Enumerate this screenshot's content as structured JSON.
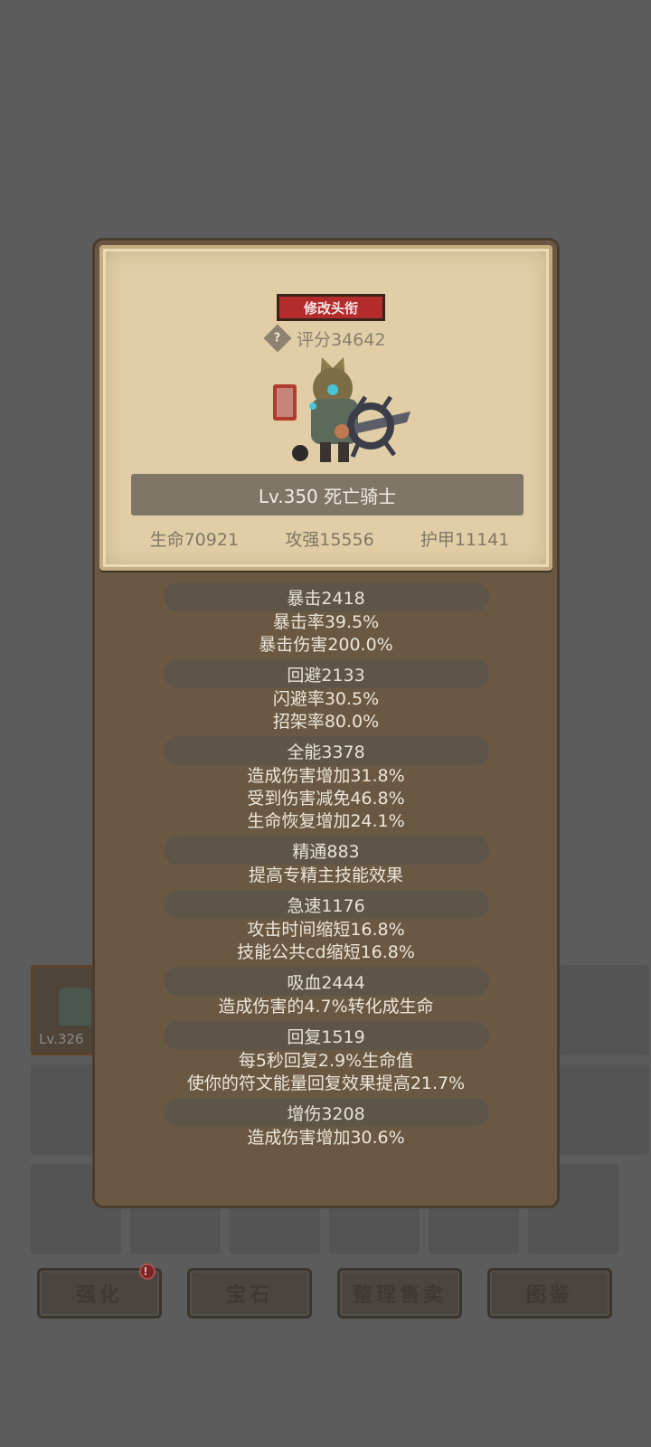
{
  "card": {
    "rename_label": "修改头衔",
    "help_glyph": "?",
    "score": "评分34642",
    "name": "Lv.350 死亡骑士",
    "hp": "生命70921",
    "attack": "攻强15556",
    "armor": "护甲11141"
  },
  "attributes": [
    {
      "title": "暴击2418",
      "lines": [
        "暴击率39.5%",
        "暴击伤害200.0%"
      ]
    },
    {
      "title": "回避2133",
      "lines": [
        "闪避率30.5%",
        "招架率80.0%"
      ]
    },
    {
      "title": "全能3378",
      "lines": [
        "造成伤害增加31.8%",
        "受到伤害减免46.8%",
        "生命恢复增加24.1%"
      ]
    },
    {
      "title": "精通883",
      "lines": [
        "提高专精主技能效果"
      ]
    },
    {
      "title": "急速1176",
      "lines": [
        "攻击时间缩短16.8%",
        "技能公共cd缩短16.8%"
      ]
    },
    {
      "title": "吸血2444",
      "lines": [
        "造成伤害的4.7%转化成生命"
      ]
    },
    {
      "title": "回复1519",
      "lines": [
        "每5秒回复2.9%生命值",
        "使你的符文能量回复效果提高21.7%"
      ]
    },
    {
      "title": "增伤3208",
      "lines": [
        "造成伤害增加30.6%"
      ]
    }
  ],
  "inventory": {
    "item_level": "Lv.326"
  },
  "bottom_buttons": [
    {
      "label": "强化",
      "badge": "!"
    },
    {
      "label": "宝石"
    },
    {
      "label": "整理售卖"
    },
    {
      "label": "图鉴"
    }
  ]
}
